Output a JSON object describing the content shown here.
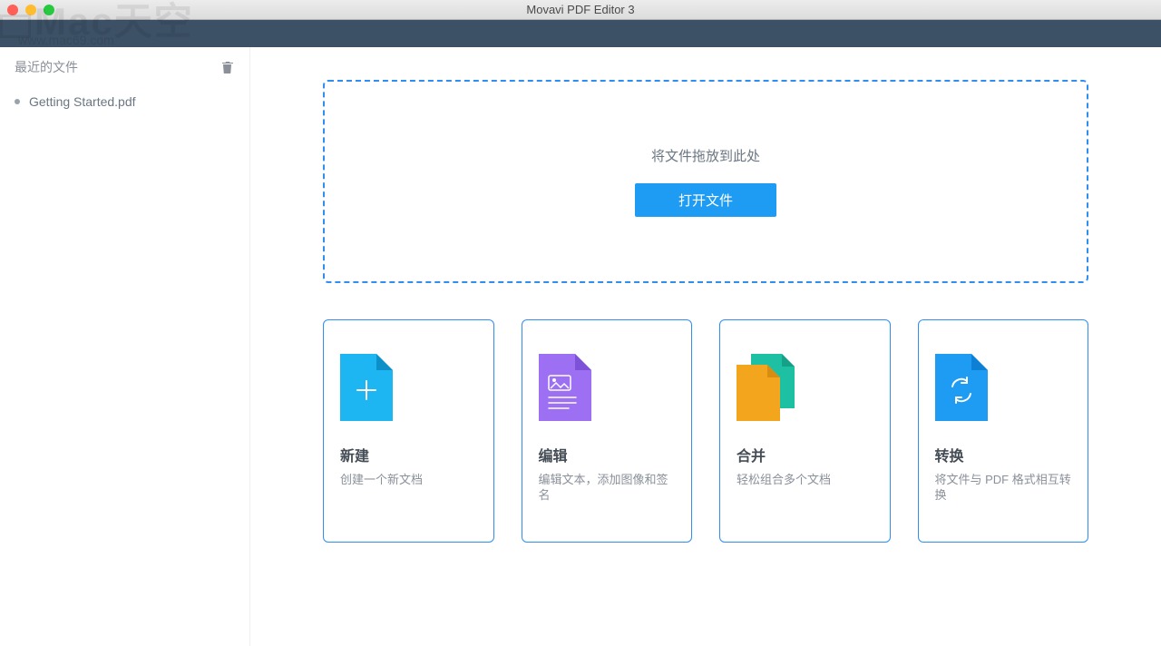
{
  "window": {
    "title": "Movavi PDF Editor 3"
  },
  "watermark": {
    "text": "Mac天空",
    "sub": "www.mac69.com"
  },
  "sidebar": {
    "recent_label": "最近的文件",
    "items": [
      {
        "label": "Getting Started.pdf"
      }
    ]
  },
  "dropzone": {
    "hint": "将文件拖放到此处",
    "open_label": "打开文件"
  },
  "cards": [
    {
      "id": "new",
      "title": "新建",
      "desc": "创建一个新文档",
      "color": "#1eb5f3"
    },
    {
      "id": "edit",
      "title": "编辑",
      "desc": "编辑文本，添加图像和签名",
      "color": "#9c6ff3"
    },
    {
      "id": "merge",
      "title": "合并",
      "desc": "轻松组合多个文档",
      "color": "#f4a51e"
    },
    {
      "id": "convert",
      "title": "转换",
      "desc": "将文件与 PDF 格式相互转换",
      "color": "#1e9bf3"
    }
  ]
}
